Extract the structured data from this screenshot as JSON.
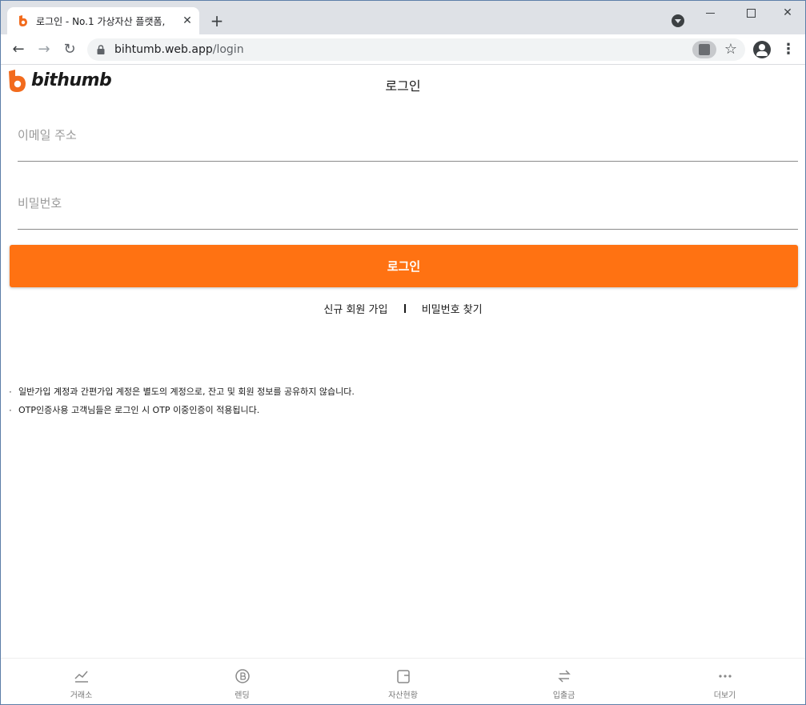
{
  "browser": {
    "tab_title": "로그인 - No.1 가상자산 플랫폼,",
    "tab_close": "✕",
    "new_tab": "+",
    "url_host": "bihtumb.web.app",
    "url_path": "/login",
    "nav_back": "←",
    "nav_forward": "→",
    "nav_reload": "↻",
    "star": "☆",
    "menu": "⋮",
    "icons": [
      "favicon-icon",
      "search-tabs-icon",
      "lock-icon",
      "translate-icon",
      "star-icon",
      "profile-icon",
      "menu-icon"
    ]
  },
  "header": {
    "logo_text": "bithumb",
    "title": "로그인"
  },
  "form": {
    "email_placeholder": "이메일 주소",
    "password_placeholder": "비밀번호",
    "login_label": "로그인"
  },
  "links": {
    "signup": "신규 회원 가입",
    "find_password": "비밀번호 찾기"
  },
  "notices": [
    "일반가입 계정과 간편가입 계정은 별도의 계정으로, 잔고 및 회원 정보를 공유하지 않습니다.",
    "OTP인증사용 고객님들은 로그인 시 OTP 이중인증이 적용됩니다."
  ],
  "bottom_nav": [
    {
      "label": "거래소",
      "icon": "chart-icon"
    },
    {
      "label": "렌딩",
      "icon": "coin-icon"
    },
    {
      "label": "자산현황",
      "icon": "wallet-icon"
    },
    {
      "label": "입출금",
      "icon": "transfer-icon"
    },
    {
      "label": "더보기",
      "icon": "more-icon"
    }
  ],
  "colors": {
    "accent": "#ff7212",
    "logo_orange": "#f26b1d",
    "text": "#1a1a1a",
    "muted": "#9a9a9a"
  }
}
